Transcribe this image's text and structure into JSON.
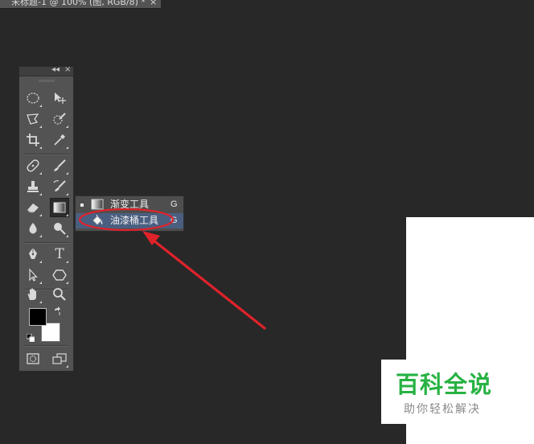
{
  "document_tab": {
    "title": "未标题-1 @ 100% (图, RGB/8) *",
    "close_glyph": "×"
  },
  "tools_panel": {
    "collapse_glyph": "◂◂",
    "close_glyph": "×",
    "tools": [
      {
        "name": "elliptical-marquee-tool",
        "icon": "ellipse-dashed-icon"
      },
      {
        "name": "move-tool",
        "icon": "move-arrow-icon"
      },
      {
        "name": "polygonal-lasso-tool",
        "icon": "polygon-lasso-icon"
      },
      {
        "name": "quick-selection-tool",
        "icon": "quick-select-brush-icon"
      },
      {
        "name": "crop-tool",
        "icon": "crop-icon"
      },
      {
        "name": "eyedropper-tool",
        "icon": "eyedropper-icon"
      },
      {
        "name": "spot-healing-brush-tool",
        "icon": "bandage-icon"
      },
      {
        "name": "brush-tool",
        "icon": "brush-icon"
      },
      {
        "name": "clone-stamp-tool",
        "icon": "stamp-icon"
      },
      {
        "name": "history-brush-tool",
        "icon": "history-brush-icon"
      },
      {
        "name": "eraser-tool",
        "icon": "eraser-icon"
      },
      {
        "name": "gradient-tool",
        "icon": "gradient-icon",
        "active": true
      },
      {
        "name": "blur-tool",
        "icon": "drop-icon"
      },
      {
        "name": "dodge-tool",
        "icon": "dodge-icon"
      },
      {
        "name": "pen-tool",
        "icon": "pen-icon"
      },
      {
        "name": "type-tool",
        "icon": "type-icon",
        "label": "T"
      },
      {
        "name": "path-selection-tool",
        "icon": "path-select-arrow-icon"
      },
      {
        "name": "shape-tool",
        "icon": "hexagon-icon"
      },
      {
        "name": "hand-tool",
        "icon": "hand-icon"
      },
      {
        "name": "zoom-tool",
        "icon": "magnifier-icon"
      }
    ],
    "foreground_color": "#000000",
    "background_color": "#ffffff"
  },
  "flyout_menu": {
    "items": [
      {
        "label": "渐变工具",
        "shortcut": "G",
        "icon": "gradient-icon",
        "current": true
      },
      {
        "label": "油漆桶工具",
        "shortcut": "G",
        "icon": "paint-bucket-icon",
        "highlighted": true
      }
    ]
  },
  "annotation": {
    "color": "#e0222a",
    "shape": "ellipse-and-arrow",
    "target": "油漆桶工具"
  },
  "watermark": {
    "title": "百科全说",
    "subtitle": "助你轻松解决",
    "title_color": "#27b243"
  }
}
